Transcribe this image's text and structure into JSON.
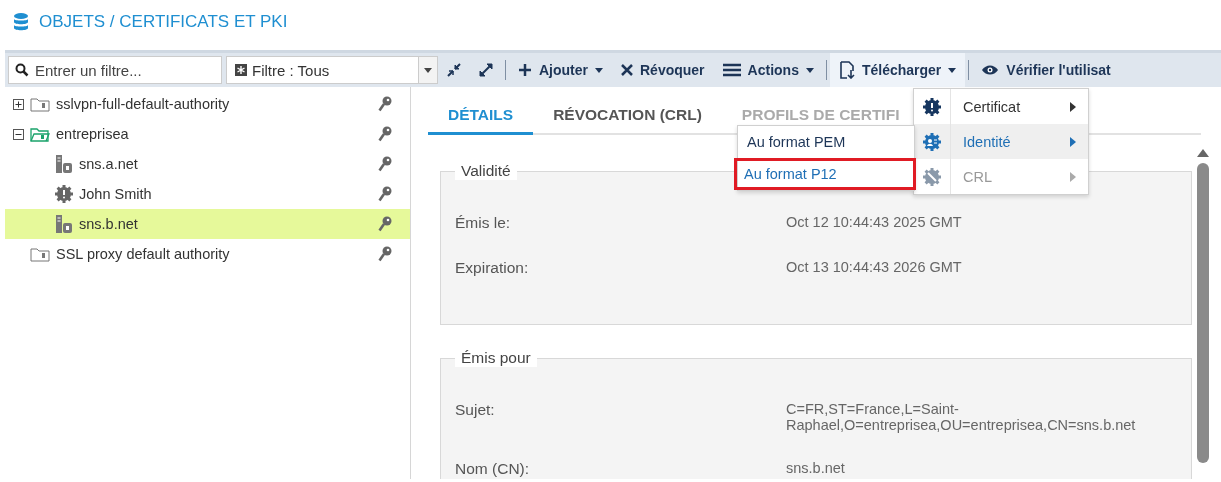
{
  "header": {
    "title": "OBJETS / CERTIFICATS ET PKI"
  },
  "toolbar": {
    "filter": {
      "placeholder": "Entrer un filtre..."
    },
    "filter_select": {
      "value": "Filtre : Tous"
    },
    "buttons": [
      {
        "kind": "collapse"
      },
      {
        "kind": "expand"
      },
      {
        "kind": "separator"
      },
      {
        "kind": "add",
        "label": "Ajouter",
        "dropdown": true,
        "active": false
      },
      {
        "kind": "revoke",
        "label": "Révoquer",
        "dropdown": false,
        "active": false
      },
      {
        "kind": "actions",
        "label": "Actions",
        "dropdown": true,
        "active": false
      },
      {
        "kind": "separator"
      },
      {
        "kind": "download",
        "label": "Télécharger",
        "dropdown": true,
        "active": true
      },
      {
        "kind": "separator"
      },
      {
        "kind": "verify",
        "label": "Vérifier l'utilisat",
        "dropdown": false,
        "active": false
      }
    ]
  },
  "tree": [
    {
      "label": "sslvpn-full-default-authority",
      "kind": "authority",
      "expanded": false,
      "selected": false
    },
    {
      "label": "entreprisea",
      "kind": "authority",
      "expanded": true,
      "selected": false,
      "children": [
        {
          "label": "sns.a.net",
          "kind": "server",
          "selected": false
        },
        {
          "label": "John Smith",
          "kind": "user",
          "selected": false
        },
        {
          "label": "sns.b.net",
          "kind": "server",
          "selected": true
        }
      ]
    },
    {
      "label": "SSL proxy default authority",
      "kind": "authority",
      "selected": false
    }
  ],
  "tabs": [
    {
      "label": "DÉTAILS",
      "selected": true
    },
    {
      "label": "RÉVOCATION (CRL)",
      "selected": false
    },
    {
      "label": "PROFILS DE CERTIFI",
      "selected": false
    }
  ],
  "sections": [
    {
      "title": "Validité",
      "rows": [
        {
          "label": "Émis le:",
          "value": "Oct 12 10:44:43 2025 GMT"
        },
        {
          "label": "Expiration:",
          "value": "Oct 13 10:44:43 2026 GMT"
        }
      ]
    },
    {
      "title": "Émis pour",
      "rows": [
        {
          "label": "Sujet:",
          "value": "C=FR,ST=France,L=Saint-Raphael,O=entreprisea,OU=entreprisea,CN=sns.b.net"
        },
        {
          "label": "Nom (CN):",
          "value": "sns.b.net"
        }
      ]
    }
  ],
  "download_menu": [
    {
      "label": "Certificat",
      "kind": "certificate",
      "selected": false,
      "disabled": false
    },
    {
      "label": "Identité",
      "kind": "identity",
      "selected": true,
      "disabled": false
    },
    {
      "label": "CRL",
      "kind": "crl",
      "selected": false,
      "disabled": true
    }
  ],
  "submenu": [
    {
      "label": "Au format PEM",
      "highlighted": false
    },
    {
      "label": "Au format P12",
      "highlighted": true
    }
  ]
}
